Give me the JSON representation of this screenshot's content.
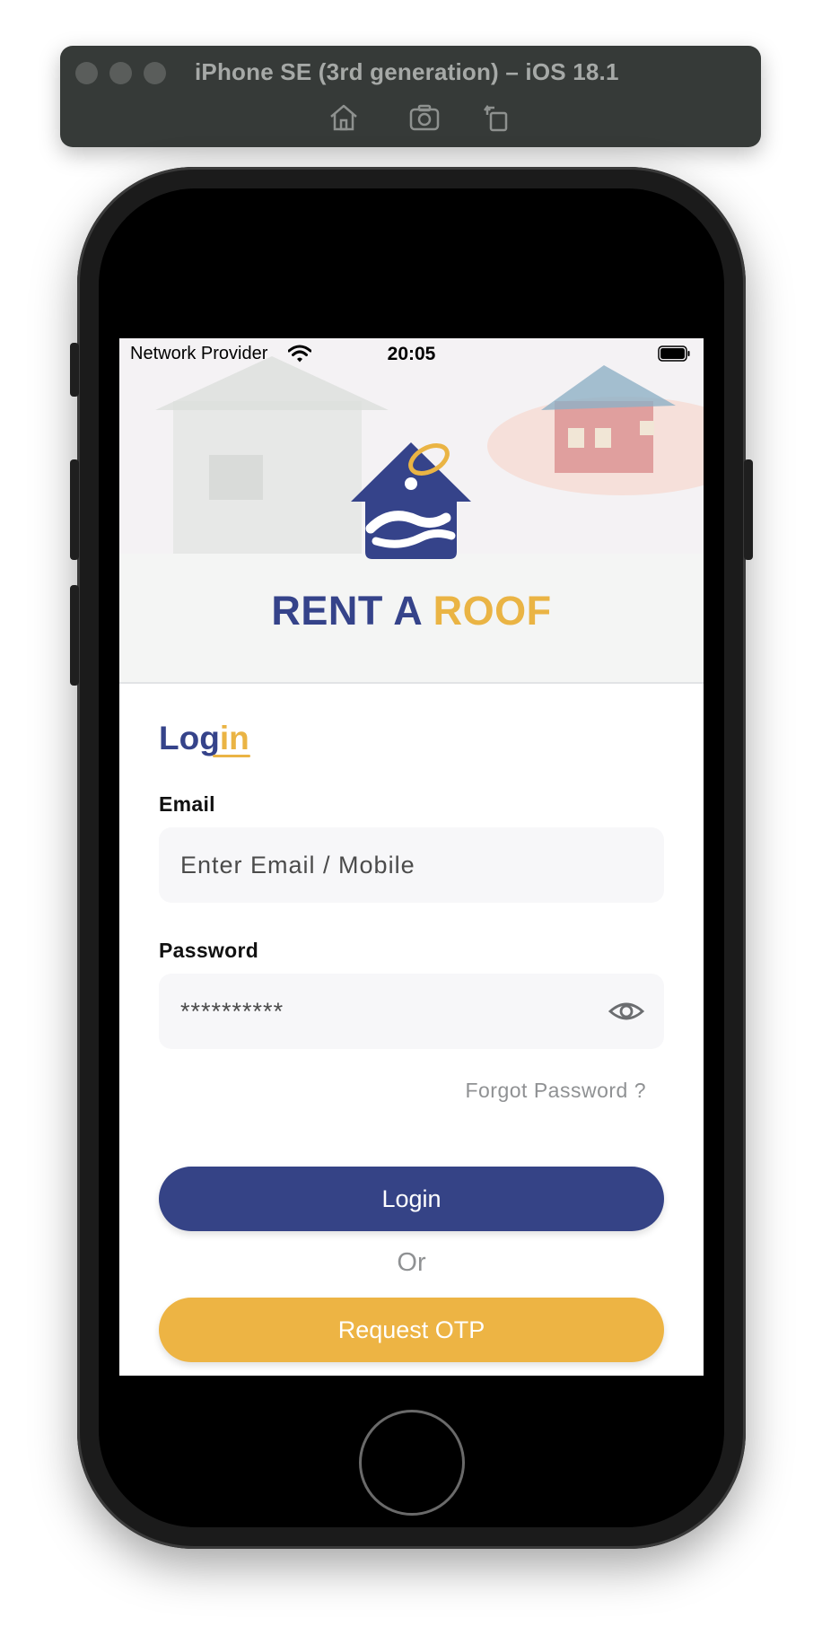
{
  "simulator": {
    "title": "iPhone SE (3rd generation) – iOS 18.1",
    "toolbar_icons": [
      "home-icon",
      "camera-icon",
      "rotate-icon"
    ]
  },
  "status_bar": {
    "carrier": "Network Provider",
    "time": "20:05",
    "icons": [
      "wifi-icon",
      "battery-icon"
    ]
  },
  "brand": {
    "name_part1": "RENT A",
    "name_part2": "ROOF",
    "logo_icon": "house-hands-logo-icon",
    "colors": {
      "primary": "#35438a",
      "accent": "#eab444"
    }
  },
  "login": {
    "title_part1": "Log",
    "title_part2": "in",
    "email_label": "Email",
    "email_placeholder": "Enter Email / Mobile",
    "password_label": "Password",
    "password_value": "**********",
    "forgot_password": "Forgot Password ?",
    "login_button": "Login",
    "or_text": "Or",
    "otp_button": "Request OTP"
  }
}
